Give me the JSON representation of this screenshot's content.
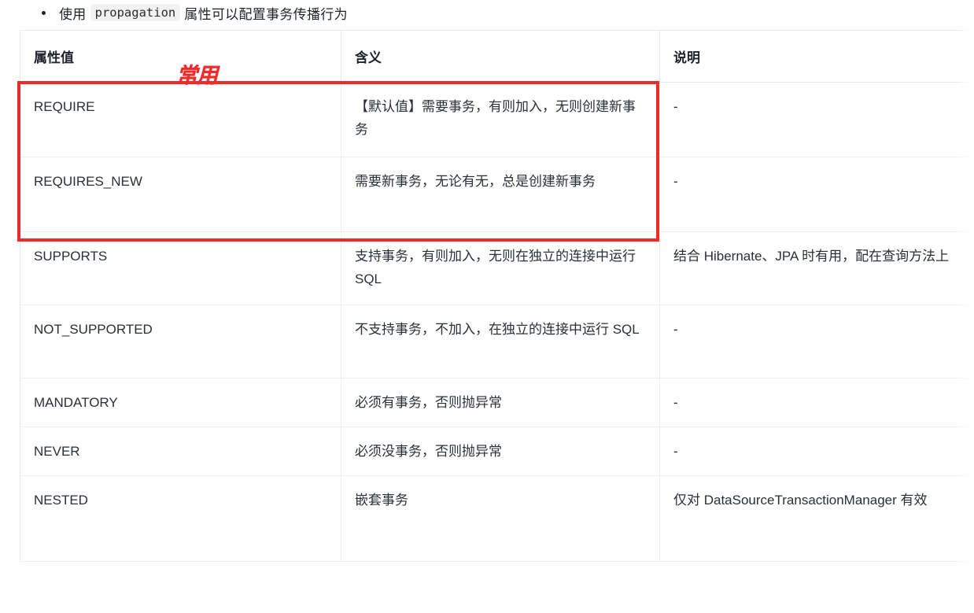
{
  "bullet": {
    "prefix": "使用",
    "code": "propagation",
    "suffix": "属性可以配置事务传播行为"
  },
  "annotation": {
    "label": "常用",
    "color": "#ee2b2b"
  },
  "table": {
    "headers": [
      "属性值",
      "含义",
      "说明"
    ],
    "rows": [
      {
        "value": "REQUIRE",
        "meaning": "【默认值】需要事务，有则加入，无则创建新事务",
        "note": "-"
      },
      {
        "value": "REQUIRES_NEW",
        "meaning": "需要新事务，无论有无，总是创建新事务",
        "note": "-"
      },
      {
        "value": "SUPPORTS",
        "meaning": "支持事务，有则加入，无则在独立的连接中运行 SQL",
        "note": "结合 Hibernate、JPA 时有用，配在查询方法上"
      },
      {
        "value": "NOT_SUPPORTED",
        "meaning": "不支持事务，不加入，在独立的连接中运行 SQL",
        "note": "-"
      },
      {
        "value": "MANDATORY",
        "meaning": "必须有事务，否则抛异常",
        "note": "-"
      },
      {
        "value": "NEVER",
        "meaning": "必须没事务，否则抛异常",
        "note": "-"
      },
      {
        "value": "NESTED",
        "meaning": "嵌套事务",
        "note": "仅对 DataSourceTransactionManager 有效"
      }
    ]
  }
}
